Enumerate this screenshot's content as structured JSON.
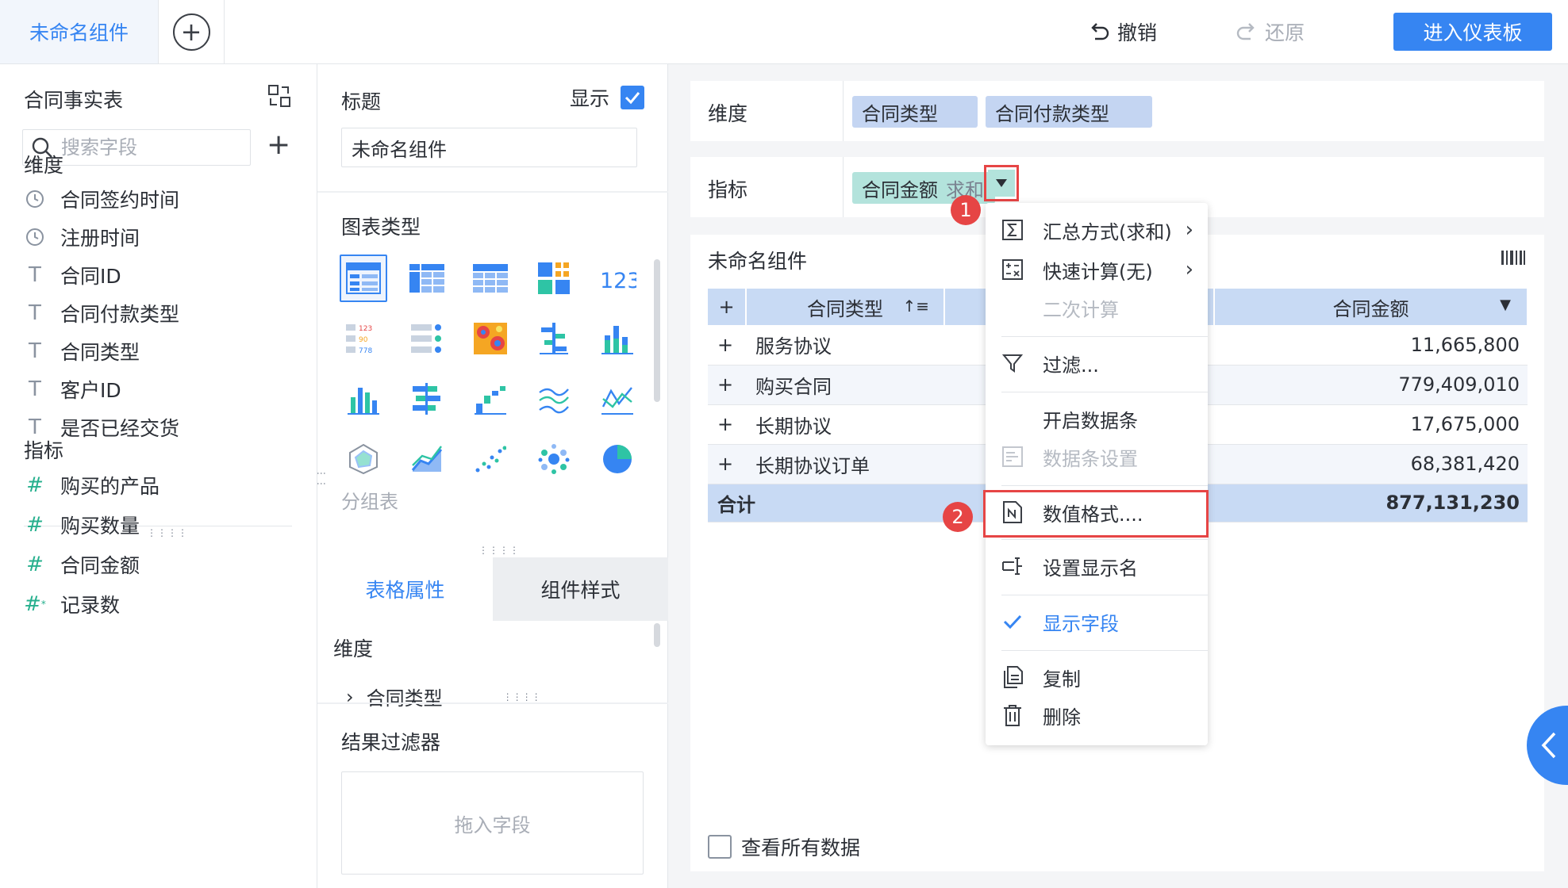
{
  "topbar": {
    "tab_label": "未命名组件",
    "undo_label": "撤销",
    "redo_label": "还原",
    "enter_dashboard_label": "进入仪表板"
  },
  "left": {
    "table_name": "合同事实表",
    "search_placeholder": "搜索字段",
    "dimension_label": "维度",
    "dimensions": [
      {
        "icon": "clock-icon",
        "label": "合同签约时间"
      },
      {
        "icon": "clock-icon",
        "label": "注册时间"
      },
      {
        "icon": "text-type-icon",
        "label": "合同ID"
      },
      {
        "icon": "text-type-icon",
        "label": "合同付款类型"
      },
      {
        "icon": "text-type-icon",
        "label": "合同类型"
      },
      {
        "icon": "text-type-icon",
        "label": "客户ID"
      },
      {
        "icon": "text-type-icon",
        "label": "是否已经交货"
      }
    ],
    "measure_label": "指标",
    "measures": [
      {
        "icon": "number-type-icon",
        "label": "购买的产品"
      },
      {
        "icon": "number-type-icon",
        "label": "购买数量"
      },
      {
        "icon": "number-type-icon",
        "label": "合同金额"
      },
      {
        "icon": "calculated-number-icon",
        "label": "记录数"
      }
    ]
  },
  "mid": {
    "title_label": "标题",
    "show_label": "显示",
    "show_checked": true,
    "title_value": "未命名组件",
    "chart_type_label": "图表类型",
    "group_table_label": "分组表",
    "tab_table_props": "表格属性",
    "tab_component_style": "组件样式",
    "dimension_label": "维度",
    "dimension_item": "合同类型",
    "result_filter_label": "结果过滤器",
    "drop_zone_label": "拖入字段"
  },
  "shelf": {
    "dimension_label": "维度",
    "dimension_pills": [
      "合同类型",
      "合同付款类型"
    ],
    "measure_label": "指标",
    "measure_pill": "合同金额",
    "measure_pill_agg": "求和"
  },
  "canvas": {
    "component_title": "未命名组件",
    "columns": [
      "合同类型",
      "合同金额"
    ],
    "rows": [
      {
        "type": "服务协议",
        "amount": "11,665,800"
      },
      {
        "type": "购买合同",
        "amount": "779,409,010"
      },
      {
        "type": "长期协议",
        "amount": "17,675,000"
      },
      {
        "type": "长期协议订单",
        "amount": "68,381,420"
      }
    ],
    "total_label": "合计",
    "total_amount": "877,131,230",
    "view_all_label": "查看所有数据"
  },
  "menu": {
    "items": [
      {
        "icon": "sigma-icon",
        "label": "汇总方式(求和)",
        "submenu": true
      },
      {
        "icon": "quick-calc-icon",
        "label": "快速计算(无)",
        "submenu": true
      },
      {
        "icon": "",
        "label": "二次计算",
        "disabled": true
      },
      {
        "icon": "filter-icon",
        "label": "过滤..."
      },
      {
        "icon": "",
        "label": "开启数据条"
      },
      {
        "icon": "databar-settings-icon",
        "label": "数据条设置",
        "disabled": true
      },
      {
        "icon": "number-format-icon",
        "label": "数值格式...."
      },
      {
        "icon": "rename-icon",
        "label": "设置显示名"
      },
      {
        "icon": "check-icon",
        "label": "显示字段",
        "selected": true
      },
      {
        "icon": "copy-icon",
        "label": "复制"
      },
      {
        "icon": "trash-icon",
        "label": "删除"
      }
    ]
  },
  "annotations": {
    "badge1": "1",
    "badge2": "2"
  },
  "colors": {
    "accent": "#3685f2",
    "dimension_pill": "#c4d5f2",
    "measure_pill": "#b3e3dc",
    "annotation_red": "#e64545"
  }
}
